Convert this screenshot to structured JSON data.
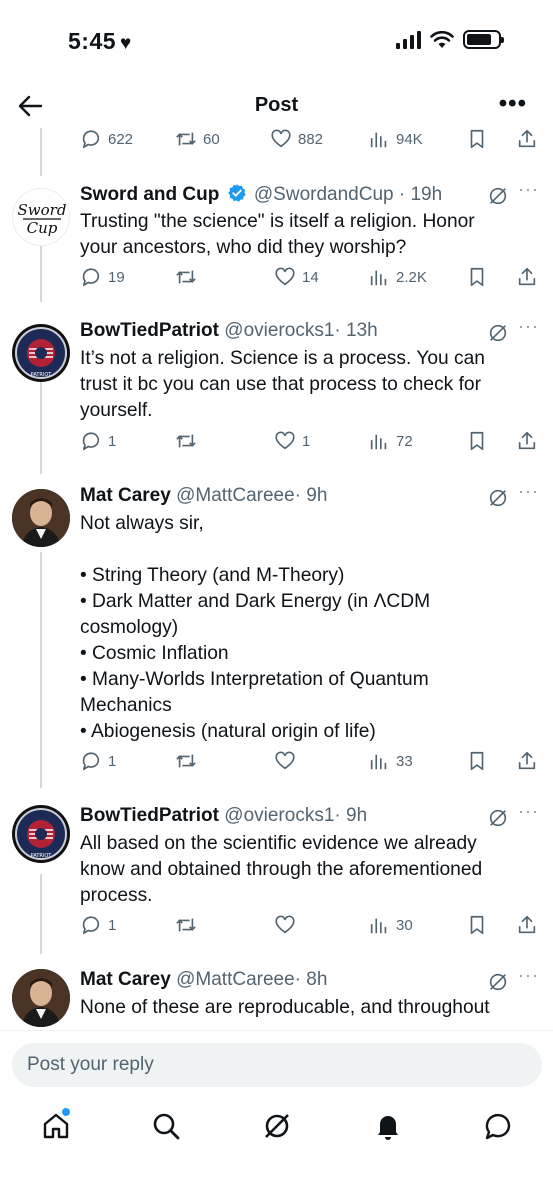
{
  "status_bar": {
    "time": "5:45"
  },
  "nav": {
    "title": "Post"
  },
  "first_actions": {
    "replies": "622",
    "reposts": "60",
    "likes": "882",
    "views": "94K"
  },
  "tweets": [
    {
      "name": "Sword and Cup",
      "handle": "@SwordandCup",
      "time": "· 19h",
      "text": "Trusting \"the science\" is itself a religion.  Honor\nyour ancestors, who did they worship?",
      "replies": "19",
      "reposts": "",
      "likes": "14",
      "views": "2.2K",
      "avatar_text": "Sword Cup"
    },
    {
      "name": "BowTiedPatriot",
      "handle": "@ovierocks1",
      "time": "· 13h",
      "text": "It’s not a religion. Science is a process. You can\ntrust it bc you can use that process to check for\nyourself.",
      "replies": "1",
      "reposts": "",
      "likes": "1",
      "views": "72",
      "avatar_text": "PATRIOT"
    },
    {
      "name": "Mat Carey",
      "handle": "@MattCareee",
      "time": "· 9h",
      "text": "Not always sir,\n\n• String Theory (and M-Theory)\n• Dark Matter and Dark Energy (in ΛCDM\ncosmology)\n• Cosmic Inflation\n• Many-Worlds Interpretation of Quantum\nMechanics\n• Abiogenesis (natural origin of life)",
      "replies": "1",
      "reposts": "",
      "likes": "",
      "views": "33"
    },
    {
      "name": "BowTiedPatriot",
      "handle": "@ovierocks1",
      "time": "· 9h",
      "text": "All based on the scientific evidence we already\nknow and obtained through the aforementioned\nprocess.",
      "replies": "1",
      "reposts": "",
      "likes": "",
      "views": "30",
      "avatar_text": "PATRIOT"
    },
    {
      "name": "Mat Carey",
      "handle": "@MattCareee",
      "time": "· 8h",
      "text": "None of these are reproducable, and throughout"
    }
  ],
  "reply_bar": {
    "placeholder": "Post your reply"
  },
  "colors": {
    "accent": "#1d9bf0",
    "secondary_text": "#536471",
    "thread_line": "#cfd9de"
  }
}
